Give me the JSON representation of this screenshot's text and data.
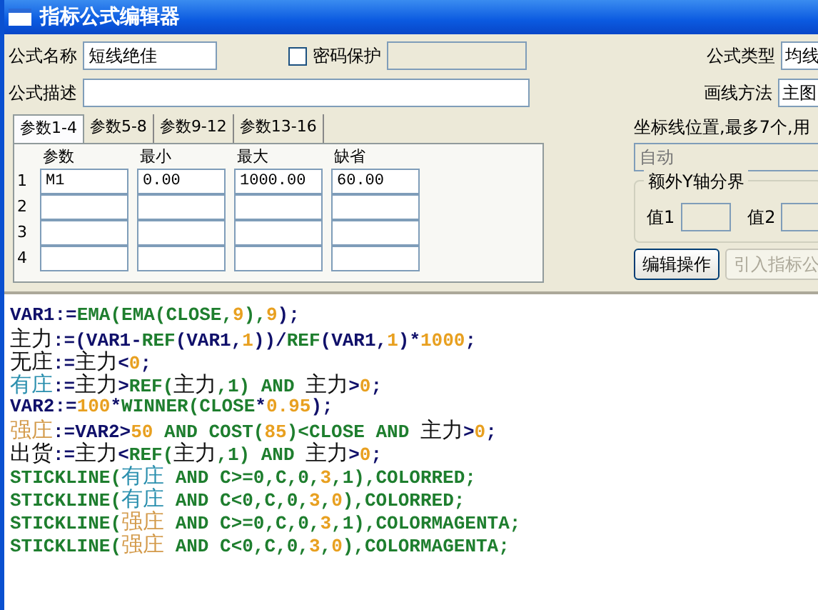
{
  "window": {
    "title": "指标公式编辑器"
  },
  "form": {
    "name_label": "公式名称",
    "name_value": "短线绝佳",
    "password": {
      "label": "密码保护",
      "checked": false
    },
    "type_label": "公式类型",
    "type_value": "均线",
    "desc_label": "公式描述",
    "draw_label": "画线方法",
    "draw_value": "主图"
  },
  "tabs": [
    {
      "label": "参数1-4",
      "selected": true
    },
    {
      "label": "参数5-8",
      "selected": false
    },
    {
      "label": "参数9-12",
      "selected": false
    },
    {
      "label": "参数13-16",
      "selected": false
    }
  ],
  "params": {
    "columns": [
      "参数",
      "最小",
      "最大",
      "缺省"
    ],
    "rows": [
      {
        "index": "1",
        "values": [
          "M1",
          "0.00",
          "1000.00",
          "60.00"
        ]
      },
      {
        "index": "2",
        "values": []
      },
      {
        "index": "3",
        "values": []
      },
      {
        "index": "4",
        "values": []
      }
    ]
  },
  "axis": {
    "label": "坐标线位置,最多7个,用",
    "placeholder": "自动",
    "group_title": "额外Y轴分界",
    "value1_label": "值1",
    "value2_label": "值2"
  },
  "buttons": [
    {
      "label": "编辑操作",
      "disabled": false
    },
    {
      "label": "引入指标公",
      "disabled": true
    }
  ],
  "code": [
    [
      {
        "kind": "var",
        "text": "VAR1:="
      },
      {
        "kind": "func",
        "text": "EMA(EMA(CLOSE,"
      },
      {
        "kind": "num",
        "text": "9"
      },
      {
        "kind": "func",
        "text": "),"
      },
      {
        "kind": "num",
        "text": "9"
      },
      {
        "kind": "var",
        "text": ");"
      }
    ],
    [
      {
        "kind": "name",
        "text": "主力"
      },
      {
        "kind": "var",
        "text": ":=(VAR1-"
      },
      {
        "kind": "func",
        "text": "REF"
      },
      {
        "kind": "var",
        "text": "(VAR1,"
      },
      {
        "kind": "num",
        "text": "1"
      },
      {
        "kind": "var",
        "text": "))/"
      },
      {
        "kind": "func",
        "text": "REF"
      },
      {
        "kind": "var",
        "text": "(VAR1,"
      },
      {
        "kind": "num",
        "text": "1"
      },
      {
        "kind": "var",
        "text": ")*"
      },
      {
        "kind": "num",
        "text": "1000"
      },
      {
        "kind": "var",
        "text": ";"
      }
    ],
    [
      {
        "kind": "name",
        "text": "无庄"
      },
      {
        "kind": "var",
        "text": ":="
      },
      {
        "kind": "name",
        "text": "主力"
      },
      {
        "kind": "var",
        "text": "<"
      },
      {
        "kind": "num",
        "text": "0"
      },
      {
        "kind": "var",
        "text": ";"
      }
    ],
    [
      {
        "kind": "teal",
        "text": "有庄"
      },
      {
        "kind": "var",
        "text": ":="
      },
      {
        "kind": "name",
        "text": "主力"
      },
      {
        "kind": "var",
        "text": ">"
      },
      {
        "kind": "func",
        "text": "REF("
      },
      {
        "kind": "name",
        "text": "主力"
      },
      {
        "kind": "func",
        "text": ",1) AND "
      },
      {
        "kind": "name",
        "text": "主力"
      },
      {
        "kind": "var",
        "text": ">"
      },
      {
        "kind": "num",
        "text": "0"
      },
      {
        "kind": "var",
        "text": ";"
      }
    ],
    [
      {
        "kind": "var",
        "text": "VAR2:="
      },
      {
        "kind": "num",
        "text": "100"
      },
      {
        "kind": "var",
        "text": "*"
      },
      {
        "kind": "func",
        "text": "WINNER(CLOSE"
      },
      {
        "kind": "var",
        "text": "*"
      },
      {
        "kind": "num",
        "text": "0.95"
      },
      {
        "kind": "var",
        "text": ");"
      }
    ],
    [
      {
        "kind": "tan",
        "text": "强庄"
      },
      {
        "kind": "var",
        "text": ":=VAR2>"
      },
      {
        "kind": "num",
        "text": "50"
      },
      {
        "kind": "func",
        "text": " AND COST("
      },
      {
        "kind": "num",
        "text": "85"
      },
      {
        "kind": "func",
        "text": ")<CLOSE AND "
      },
      {
        "kind": "name",
        "text": "主力"
      },
      {
        "kind": "var",
        "text": ">"
      },
      {
        "kind": "num",
        "text": "0"
      },
      {
        "kind": "var",
        "text": ";"
      }
    ],
    [
      {
        "kind": "name",
        "text": "出货"
      },
      {
        "kind": "var",
        "text": ":="
      },
      {
        "kind": "name",
        "text": "主力"
      },
      {
        "kind": "var",
        "text": "<"
      },
      {
        "kind": "func",
        "text": "REF("
      },
      {
        "kind": "name",
        "text": "主力"
      },
      {
        "kind": "func",
        "text": ",1) AND "
      },
      {
        "kind": "name",
        "text": "主力"
      },
      {
        "kind": "var",
        "text": ">"
      },
      {
        "kind": "num",
        "text": "0"
      },
      {
        "kind": "var",
        "text": ";"
      }
    ],
    [
      {
        "kind": "func",
        "text": "STICKLINE("
      },
      {
        "kind": "teal",
        "text": "有庄"
      },
      {
        "kind": "func",
        "text": " AND C>=0,C,0,"
      },
      {
        "kind": "num",
        "text": "3"
      },
      {
        "kind": "func",
        "text": ",1),COLORRED;"
      }
    ],
    [
      {
        "kind": "func",
        "text": "STICKLINE("
      },
      {
        "kind": "teal",
        "text": "有庄"
      },
      {
        "kind": "func",
        "text": " AND C<0,C,0,"
      },
      {
        "kind": "num",
        "text": "3"
      },
      {
        "kind": "func",
        "text": ","
      },
      {
        "kind": "num",
        "text": "0"
      },
      {
        "kind": "func",
        "text": "),COLORRED;"
      }
    ],
    [
      {
        "kind": "func",
        "text": "STICKLINE("
      },
      {
        "kind": "tan",
        "text": "强庄"
      },
      {
        "kind": "func",
        "text": " AND C>=0,C,0,"
      },
      {
        "kind": "num",
        "text": "3"
      },
      {
        "kind": "func",
        "text": ",1),COLORMAGENTA;"
      }
    ],
    [
      {
        "kind": "func",
        "text": "STICKLINE("
      },
      {
        "kind": "tan",
        "text": "强庄"
      },
      {
        "kind": "func",
        "text": " AND C<0,C,0,"
      },
      {
        "kind": "num",
        "text": "3"
      },
      {
        "kind": "func",
        "text": ","
      },
      {
        "kind": "num",
        "text": "0"
      },
      {
        "kind": "func",
        "text": "),COLORMAGENTA;"
      }
    ]
  ]
}
